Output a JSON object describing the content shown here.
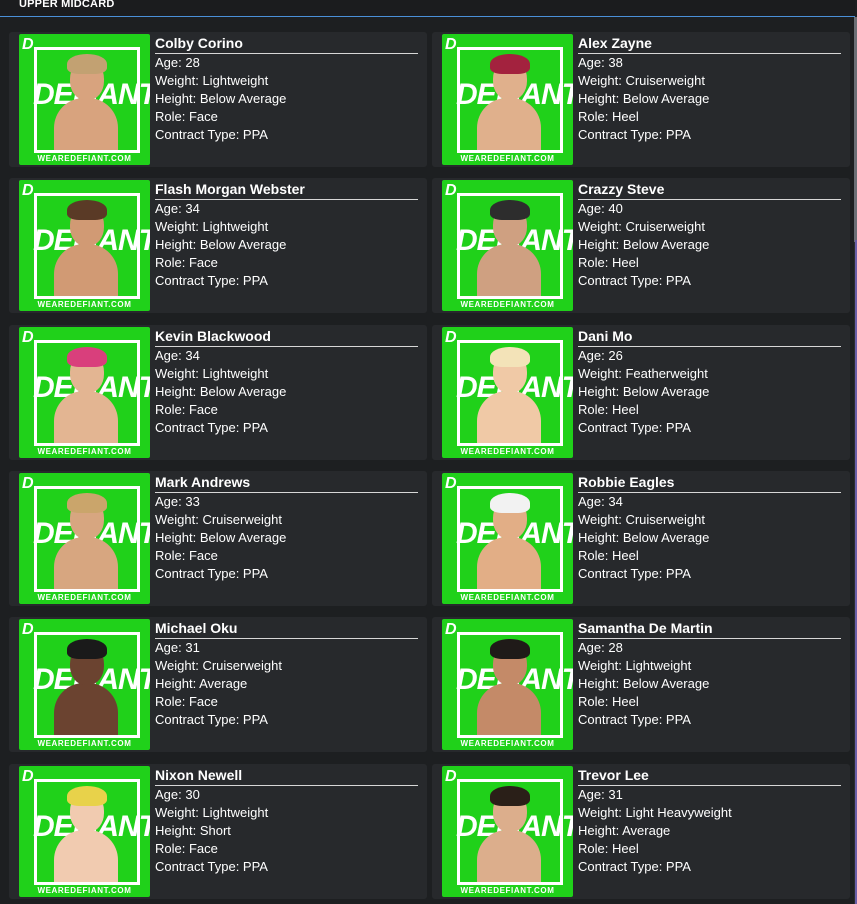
{
  "section": {
    "title": "UPPER MIDCARD"
  },
  "poster": {
    "brand": "DEFIANT",
    "url": "WEAREDEFIANT.COM",
    "logo": "D"
  },
  "colors": {
    "poster_green": "#20d11a",
    "card_bg": "#27292c",
    "page_bg": "#1d1f21",
    "accent_line": "#4a8fd8"
  },
  "labels": {
    "age": "Age: ",
    "weight": "Weight: ",
    "height": "Height: ",
    "role": "Role: ",
    "contract": "Contract Type: "
  },
  "wrestlers": [
    {
      "name": "Colby Corino",
      "age": "28",
      "weight": "Lightweight",
      "height": "Below Average",
      "role": "Face",
      "contract": "PPA"
    },
    {
      "name": "Alex Zayne",
      "age": "38",
      "weight": "Cruiserweight",
      "height": "Below Average",
      "role": "Heel",
      "contract": "PPA"
    },
    {
      "name": "Flash Morgan Webster",
      "age": "34",
      "weight": "Lightweight",
      "height": "Below Average",
      "role": "Face",
      "contract": "PPA"
    },
    {
      "name": "Crazzy Steve",
      "age": "40",
      "weight": "Cruiserweight",
      "height": "Below Average",
      "role": "Heel",
      "contract": "PPA"
    },
    {
      "name": "Kevin Blackwood",
      "age": "34",
      "weight": "Lightweight",
      "height": "Below Average",
      "role": "Face",
      "contract": "PPA"
    },
    {
      "name": "Dani Mo",
      "age": "26",
      "weight": "Featherweight",
      "height": "Below Average",
      "role": "Heel",
      "contract": "PPA"
    },
    {
      "name": "Mark Andrews",
      "age": "33",
      "weight": "Cruiserweight",
      "height": "Below Average",
      "role": "Face",
      "contract": "PPA"
    },
    {
      "name": "Robbie Eagles",
      "age": "34",
      "weight": "Cruiserweight",
      "height": "Below Average",
      "role": "Heel",
      "contract": "PPA"
    },
    {
      "name": "Michael Oku",
      "age": "31",
      "weight": "Cruiserweight",
      "height": "Average",
      "role": "Face",
      "contract": "PPA"
    },
    {
      "name": "Samantha De Martin",
      "age": "28",
      "weight": "Lightweight",
      "height": "Below Average",
      "role": "Heel",
      "contract": "PPA"
    },
    {
      "name": "Nixon Newell",
      "age": "30",
      "weight": "Lightweight",
      "height": "Short",
      "role": "Face",
      "contract": "PPA"
    },
    {
      "name": "Trevor Lee",
      "age": "31",
      "weight": "Light Heavyweight",
      "height": "Average",
      "role": "Heel",
      "contract": "PPA"
    }
  ]
}
